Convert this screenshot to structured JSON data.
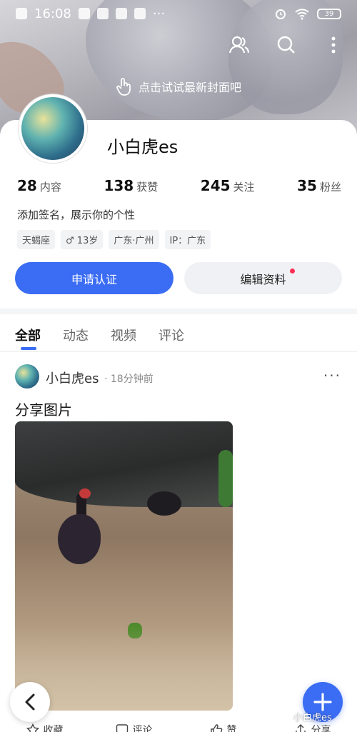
{
  "status_bar": {
    "time": "16:08",
    "battery": "39"
  },
  "cover": {
    "hint": "点击试试最新封面吧"
  },
  "profile": {
    "username": "小白虎es",
    "stats": [
      {
        "num": "28",
        "label": "内容"
      },
      {
        "num": "138",
        "label": "获赞"
      },
      {
        "num": "245",
        "label": "关注"
      },
      {
        "num": "35",
        "label": "粉丝"
      }
    ],
    "signature": "添加签名，展示你的个性",
    "tags": [
      "天蝎座",
      "♂ 13岁",
      "广东·广州",
      "IP：广东"
    ]
  },
  "buttons": {
    "apply_cert": "申请认证",
    "edit_profile": "编辑资料"
  },
  "tabs": [
    "全部",
    "动态",
    "视频",
    "评论"
  ],
  "post": {
    "author": "小白虎es",
    "time": "· 18分钟前",
    "text": "分享图片",
    "more": "···"
  },
  "actions": [
    "收藏",
    "评论",
    "赞",
    "分享"
  ],
  "watermark": "小白虎es",
  "colors": {
    "accent": "#3a6cf4",
    "badge": "#ff2d55"
  },
  "icons": {
    "top": [
      "user-group-icon",
      "search-icon",
      "more-vertical-icon"
    ],
    "cover_hint": "tap-hand-icon",
    "back": "chevron-left-icon",
    "fab": "plus-icon"
  }
}
